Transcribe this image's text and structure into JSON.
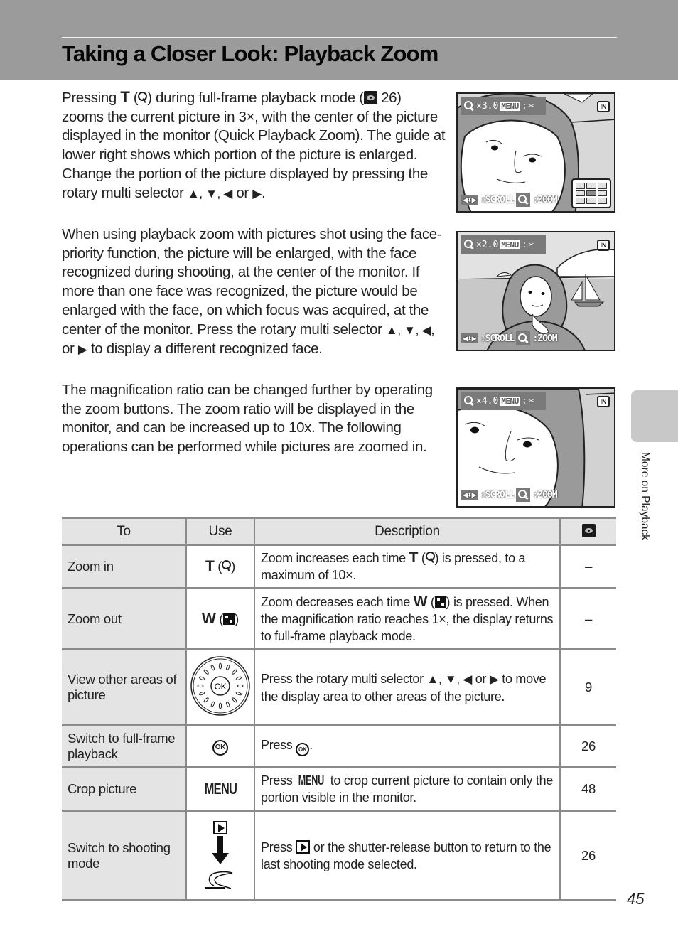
{
  "header": {
    "title": "Taking a Closer Look: Playback Zoom"
  },
  "paragraphs": {
    "p1": {
      "t1": "Pressing ",
      "key": "T",
      "t2": " (",
      "t3": ") during full-frame playback mode (",
      "ref": " 26)",
      "t4": " zooms the current picture in 3×, with the center of the picture displayed in the monitor (Quick Playback Zoom). The guide at lower right shows which portion of the picture is enlarged. Change the portion of the picture displayed by pressing the rotary multi selector ",
      "arrows": "▲, ▼, ◀",
      "t5": " or ",
      "right": "▶",
      "t6": "."
    },
    "p2": {
      "t1": "When using playback zoom with pictures shot using the face-priority function, the picture will be enlarged, with the face recognized during shooting, at the center of the monitor. If more than one face was recognized, the picture would be enlarged with the face, on which focus was acquired, at the center of the monitor. Press the rotary multi selector ",
      "arrows": "▲, ▼, ◀",
      "t2": ", or ",
      "right": "▶",
      "t3": " to display a different recognized face."
    },
    "p3": "The magnification ratio can be changed further by operating the zoom buttons. The zoom ratio will be displayed in the monitor, and can be increased up to 10x. The following operations can be performed while pictures are zoomed in."
  },
  "screens": [
    {
      "zoom": "×3.0",
      "menu": "MENU",
      "sep": ":",
      "crop_icon": "scissors-icon",
      "memory": "IN",
      "scroll": ":SCROLL",
      "zoom_label": ":ZOOM",
      "guide_grid": true
    },
    {
      "zoom": "×2.0",
      "menu": "MENU",
      "sep": ":",
      "crop_icon": "scissors-icon",
      "memory": "IN",
      "scroll": ":SCROLL",
      "zoom_label": ":ZOOM",
      "guide_grid": false
    },
    {
      "zoom": "×4.0",
      "menu": "MENU",
      "sep": ":",
      "crop_icon": "scissors-icon",
      "memory": "IN",
      "scroll": ":SCROLL",
      "zoom_label": ":ZOOM",
      "guide_grid": false
    }
  ],
  "side_tab": {
    "label": "More on Playback"
  },
  "table": {
    "headers": [
      "To",
      "Use",
      "Description",
      "page-ref-icon"
    ],
    "rows": [
      {
        "to": "Zoom in",
        "use_key": "T",
        "use_icon": "zoom-in-icon",
        "desc_1": "Zoom increases each time ",
        "desc_key": "T",
        "desc_2": " is pressed, to a maximum of 10×.",
        "ref": "–"
      },
      {
        "to": "Zoom out",
        "use_key": "W",
        "use_icon": "thumbnail-icon",
        "desc_1": "Zoom decreases each time ",
        "desc_key": "W",
        "desc_2": " is pressed. When the magnification ratio reaches 1×, the display returns to full-frame playback mode.",
        "ref": "–"
      },
      {
        "to": "View other areas of picture",
        "use_icon": "rotary-multi-selector-icon",
        "ok": "OK",
        "desc_1": "Press the rotary multi selector ",
        "desc_arrows": "▲, ▼, ◀",
        "desc_or": " or ",
        "desc_right": "▶",
        "desc_2": " to move the display area to other areas of the picture.",
        "ref": "9"
      },
      {
        "to": "Switch to full-frame playback",
        "use_icon": "ok-button-icon",
        "ok": "OK",
        "desc_1": "Press ",
        "desc_2": ".",
        "ref": "26"
      },
      {
        "to": "Crop picture",
        "use_label": "MENU",
        "desc_1": "Press ",
        "desc_key": "MENU",
        "desc_2": " to crop current picture to contain only the portion visible in the monitor.",
        "ref": "48"
      },
      {
        "to": "Switch to shooting mode",
        "use_icon": "playback-button-icon",
        "desc_1": "Press ",
        "desc_2": " or the shutter-release button to return to the last shooting mode selected.",
        "ref": "26"
      }
    ]
  },
  "footer": {
    "page_number": "45"
  }
}
